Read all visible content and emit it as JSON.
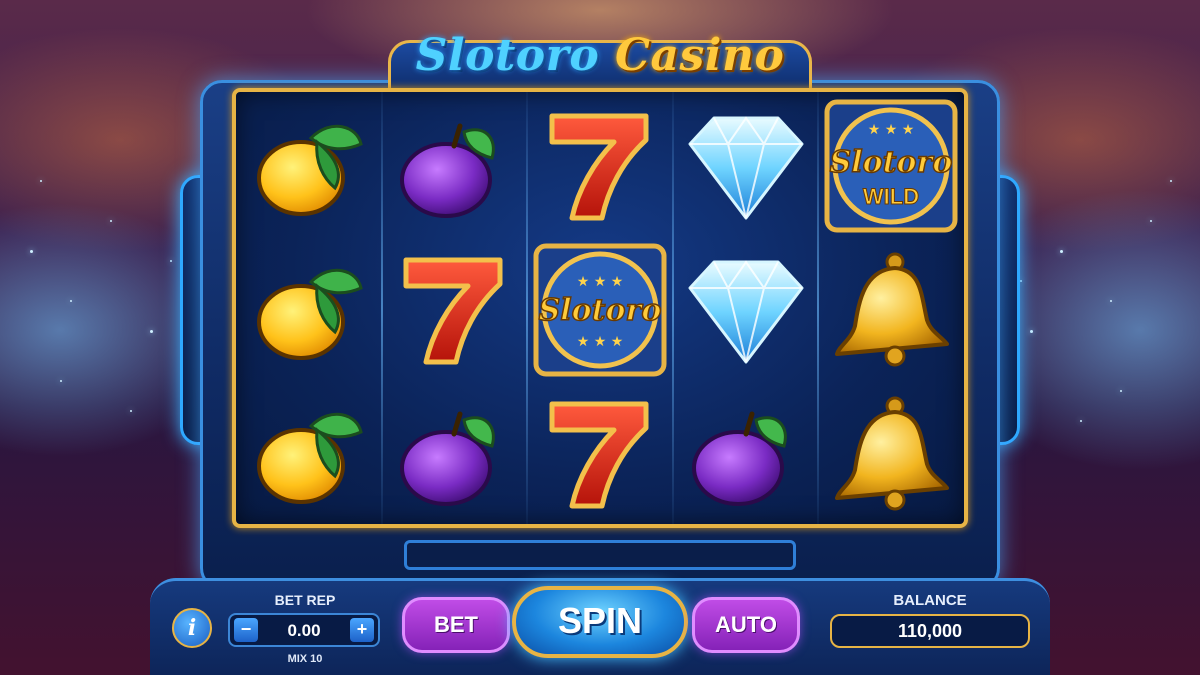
{
  "header": {
    "title_part1": "Slotoro",
    "title_part2": "Casino"
  },
  "reels": {
    "columns": 5,
    "rows": 3,
    "grid": [
      [
        "lemon",
        "plum",
        "seven",
        "diamond",
        "wild"
      ],
      [
        "lemon",
        "seven",
        "slotoro-logo",
        "diamond",
        "bell"
      ],
      [
        "lemon",
        "plum",
        "seven",
        "plum",
        "bell"
      ]
    ],
    "logo_text": "Slotoro",
    "wild_text": "WILD"
  },
  "controls": {
    "info_label": "i",
    "bet_rep_label": "BET REP",
    "bet_value": "0.00",
    "minus_label": "−",
    "plus_label": "+",
    "mix_label": "MIX 10",
    "bet_button_label": "BET",
    "spin_button_label": "SPIN",
    "auto_button_label": "AUTO",
    "balance_label": "BALANCE",
    "balance_value": "110,000"
  },
  "colors": {
    "gold": "#e7b445",
    "cabinet_blue": "#163a7e",
    "neon_blue": "#3fb4ff",
    "purple_button": "#9a2fcc"
  }
}
